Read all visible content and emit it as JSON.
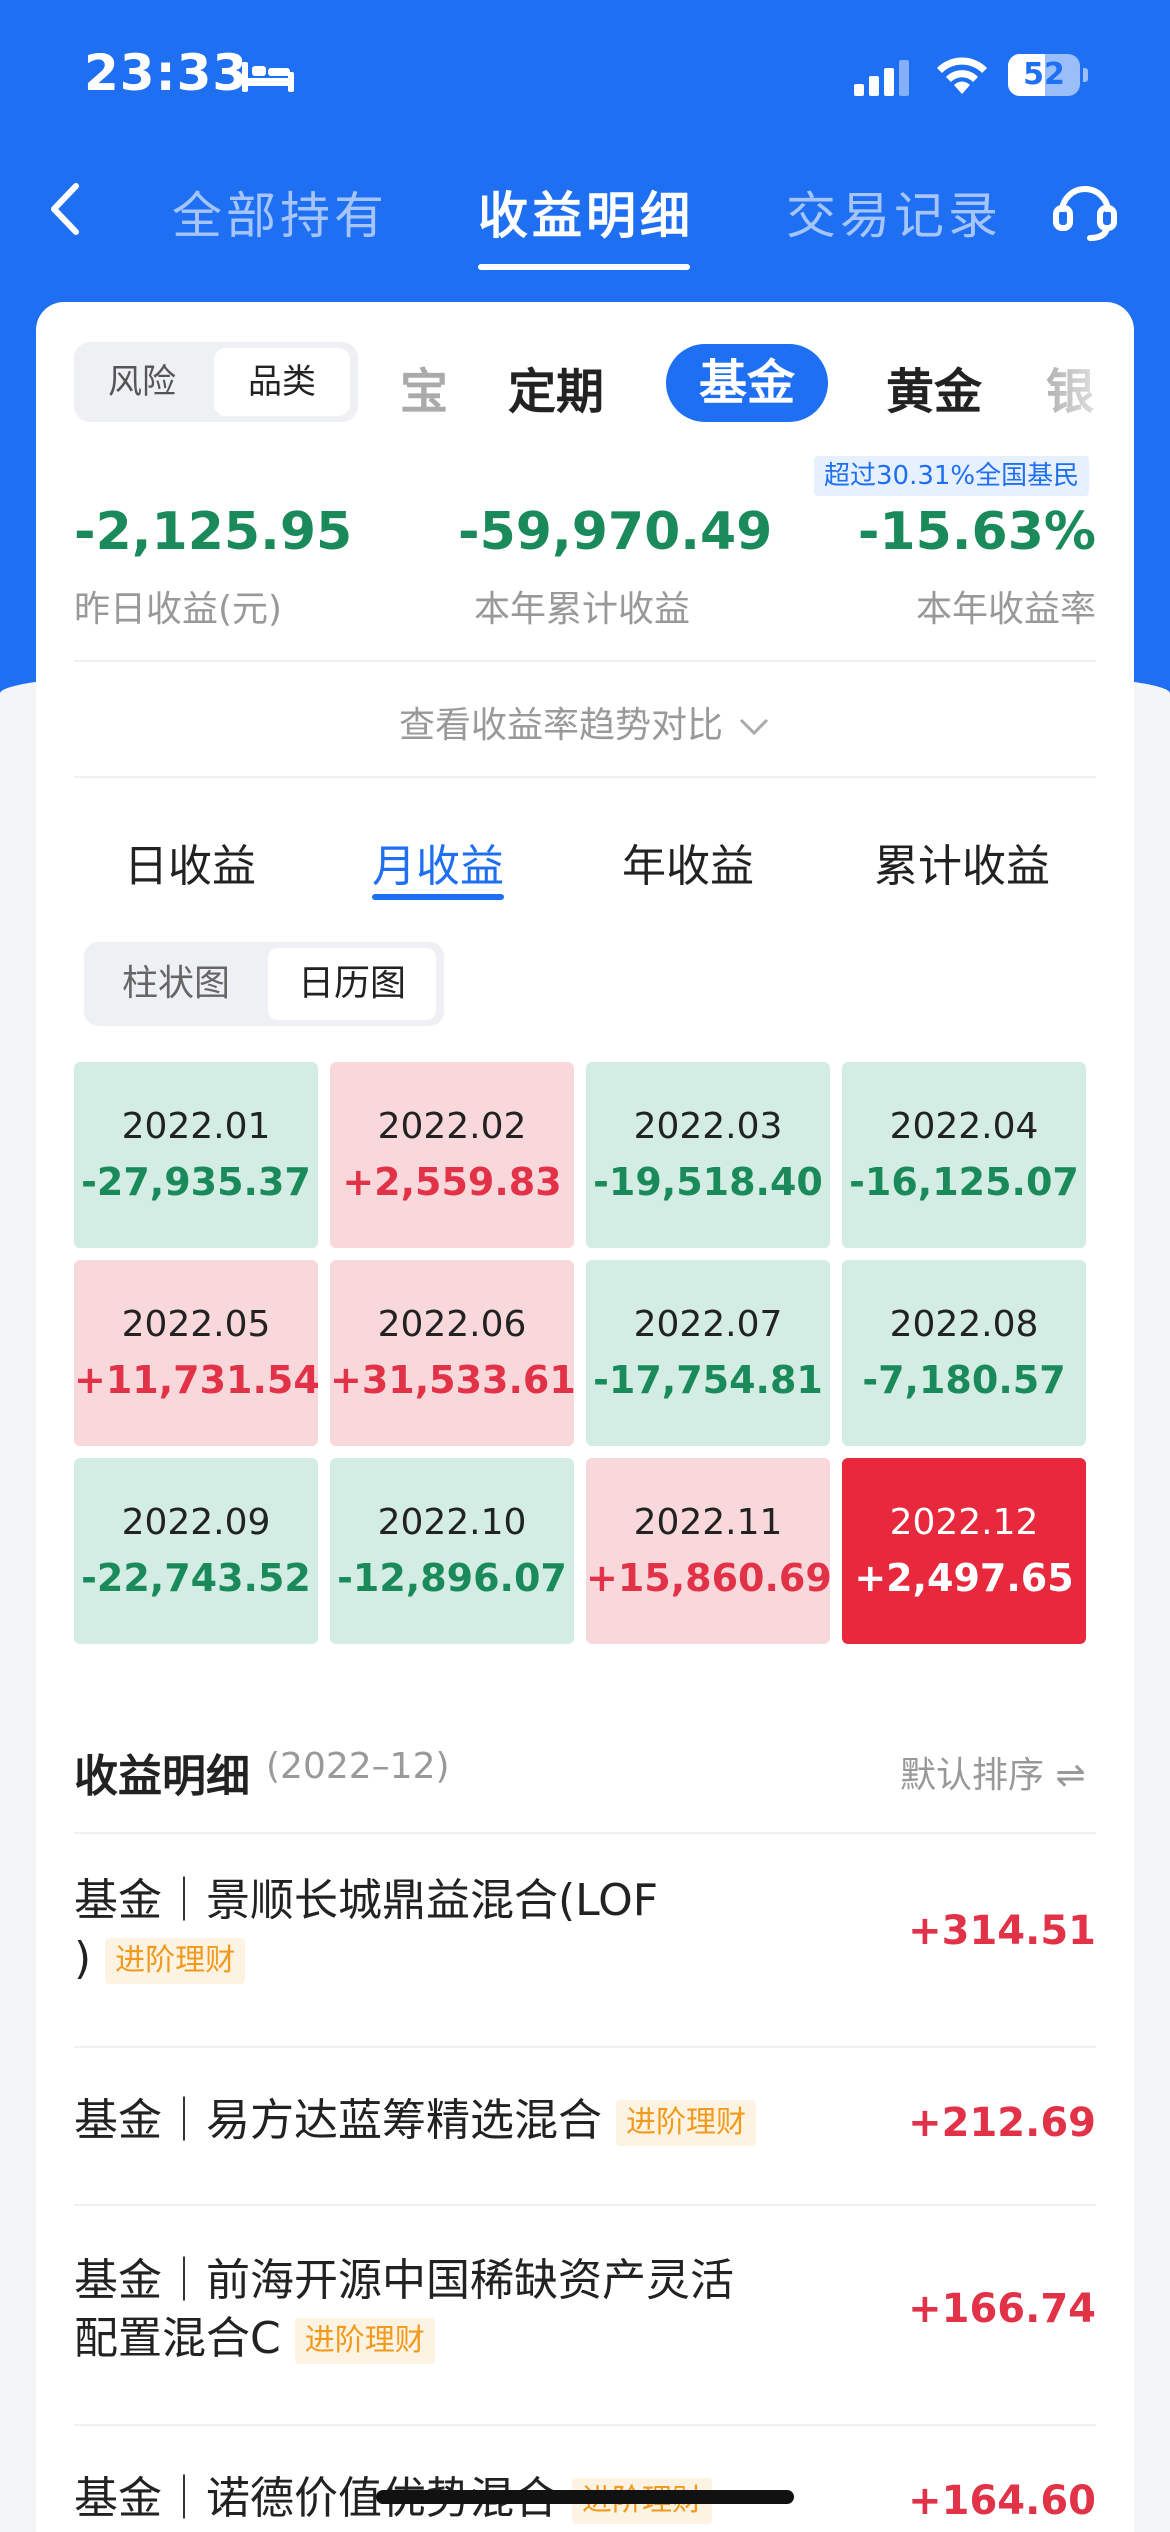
{
  "status_bar": {
    "time": "23:33",
    "battery": "52",
    "battery_level": 0.52
  },
  "nav": {
    "tabs": [
      {
        "label": "全部持有",
        "active": false
      },
      {
        "label": "收益明细",
        "active": true
      },
      {
        "label": "交易记录",
        "active": false
      }
    ]
  },
  "segment": {
    "options": [
      "风险",
      "品类"
    ],
    "active": "品类"
  },
  "categories": [
    "宝",
    "定期",
    "基金",
    "黄金",
    "银"
  ],
  "active_category": "基金",
  "summary": {
    "rank_badge": "超过30.31%全国基民",
    "yesterday_value": "-2,125.95",
    "yesterday_label": "昨日收益(元)",
    "ytd_value": "-59,970.49",
    "ytd_label": "本年累计收益",
    "rate_value": "-15.63%",
    "rate_label": "本年收益率"
  },
  "trend_link": "查看收益率趋势对比",
  "periods": [
    "日收益",
    "月收益",
    "年收益",
    "累计收益"
  ],
  "active_period": "月收益",
  "chart_toggle": {
    "options": [
      "柱状图",
      "日历图"
    ],
    "active": "日历图"
  },
  "calendar": [
    {
      "month": "2022.01",
      "value": "-27,935.37",
      "type": "loss"
    },
    {
      "month": "2022.02",
      "value": "+2,559.83",
      "type": "gain"
    },
    {
      "month": "2022.03",
      "value": "-19,518.40",
      "type": "loss"
    },
    {
      "month": "2022.04",
      "value": "-16,125.07",
      "type": "loss"
    },
    {
      "month": "2022.05",
      "value": "+11,731.54",
      "type": "gain"
    },
    {
      "month": "2022.06",
      "value": "+31,533.61",
      "type": "gain"
    },
    {
      "month": "2022.07",
      "value": "-17,754.81",
      "type": "loss"
    },
    {
      "month": "2022.08",
      "value": "-7,180.57",
      "type": "loss"
    },
    {
      "month": "2022.09",
      "value": "-22,743.52",
      "type": "loss"
    },
    {
      "month": "2022.10",
      "value": "-12,896.07",
      "type": "loss"
    },
    {
      "month": "2022.11",
      "value": "+15,860.69",
      "type": "gain"
    },
    {
      "month": "2022.12",
      "value": "+2,497.65",
      "type": "selected"
    }
  ],
  "detail": {
    "title": "收益明细",
    "period": "(2022–12)",
    "sort_label": "默认排序 ⇌"
  },
  "funds": [
    {
      "line1": "基金｜景顺长城鼎益混合(LOF",
      "line2": ")",
      "tag": "进阶理财",
      "amount": "+314.51"
    },
    {
      "line1": "基金｜易方达蓝筹精选混合",
      "line2": "",
      "tag": "进阶理财",
      "amount": "+212.69"
    },
    {
      "line1": "基金｜前海开源中国稀缺资产灵活",
      "line2": "配置混合C",
      "tag": "进阶理财",
      "amount": "+166.74"
    },
    {
      "line1": "基金｜诺德价值优势混合",
      "line2": "",
      "tag": "进阶理财",
      "amount": "+164.60"
    }
  ]
}
